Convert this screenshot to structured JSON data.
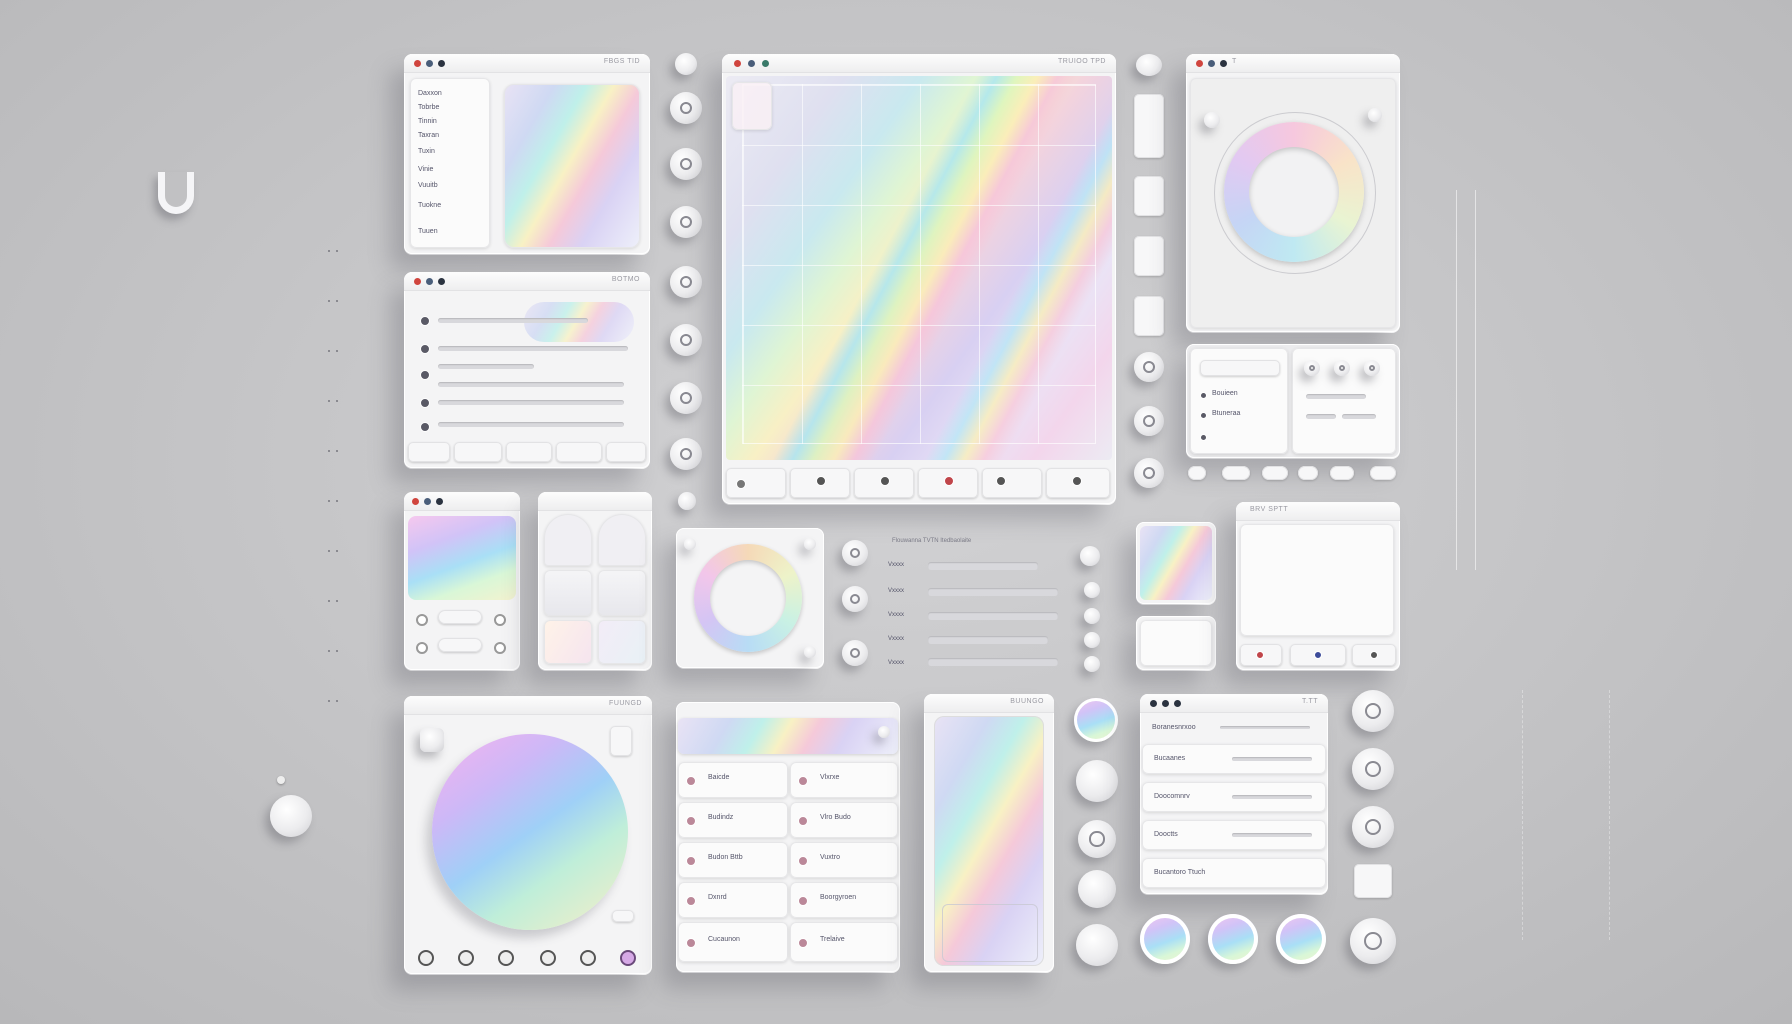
{
  "brand": {
    "logo_letter": "U"
  },
  "windows": {
    "top_left": {
      "title": "FBGS TID",
      "sidebar_items": [
        "Daxxon",
        "Tobrbe",
        "Tinnin",
        "Taxran",
        "Tuxin",
        "Vinie",
        "Vuuitb",
        "Tuokne",
        "Tuuen"
      ]
    },
    "list_window": {
      "title": "BOTMO"
    },
    "main_canvas": {
      "title": "TRUIOO TPD"
    },
    "ring_window": {
      "title": "T"
    },
    "preview_window": {
      "title": "BRV  SPTT"
    },
    "big_circle_window": {
      "title": "FUUNGD"
    },
    "phone_window": {
      "title": "BUUNGO"
    },
    "list_right": {
      "title": "T.TT"
    },
    "grid_list": {
      "title": ""
    }
  },
  "stats_panel": {
    "items": [
      "Bouieen",
      "Btuneraa"
    ]
  },
  "slider_panel": {
    "header": "Flouwanna TVTN  Itedbaolaite",
    "labels": [
      "Vxxxx",
      "Vxxxx",
      "Vxxxx",
      "Vxxxx",
      "Vxxxx"
    ]
  },
  "grid_list_cells": [
    [
      "Baicde",
      "Vlxrxe"
    ],
    [
      "Budindz",
      "Vlro Budo"
    ],
    [
      "Budon Bttb",
      "Vuxtro"
    ],
    [
      "Dxnrd",
      "Boorgyroen"
    ],
    [
      "Cucaunon",
      "Trelaive"
    ]
  ],
  "right_list": {
    "header": "Boranesnrxoo",
    "rows": [
      "Bucaanes",
      "Doocomnrv",
      "Dooctts",
      "Bucantoro Ttuch"
    ]
  },
  "colors": {
    "background": "#c8c8ca",
    "window": "#f4f4f5",
    "accent_dark": "#2b3340",
    "accent_red": "#d0453e"
  }
}
